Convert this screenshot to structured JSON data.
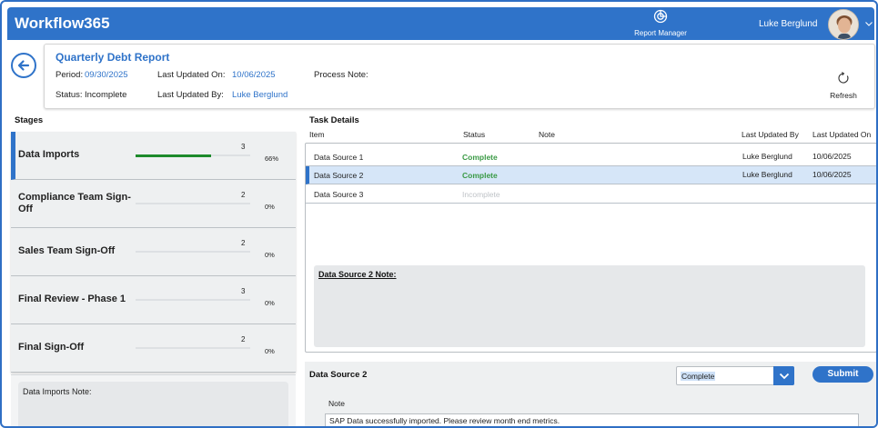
{
  "app": {
    "title": "Workflow365"
  },
  "header": {
    "report_manager_label": "Report Manager",
    "user_name": "Luke Berglund"
  },
  "report": {
    "title": "Quarterly Debt Report",
    "period_label": "Period:",
    "period_value": "09/30/2025",
    "last_updated_on_label": "Last Updated On:",
    "last_updated_on_value": "10/06/2025",
    "process_note_label": "Process Note:",
    "status_label": "Status:",
    "status_value": "Incomplete",
    "last_updated_by_label": "Last Updated By:",
    "last_updated_by_value": "Luke Berglund",
    "refresh_label": "Refresh"
  },
  "stages": {
    "title": "Stages",
    "items": [
      {
        "name": "Data Imports",
        "count": "3",
        "percent_label": "66%",
        "progress": 0.66,
        "active": true
      },
      {
        "name": "Compliance Team Sign-Off",
        "count": "2",
        "percent_label": "0%",
        "progress": 0,
        "active": false
      },
      {
        "name": "Sales Team Sign-Off",
        "count": "2",
        "percent_label": "0%",
        "progress": 0,
        "active": false
      },
      {
        "name": "Final Review - Phase 1",
        "count": "3",
        "percent_label": "0%",
        "progress": 0,
        "active": false
      },
      {
        "name": "Final Sign-Off",
        "count": "2",
        "percent_label": "0%",
        "progress": 0,
        "active": false
      }
    ],
    "note_label": "Data Imports Note:"
  },
  "tasks": {
    "title": "Task Details",
    "columns": {
      "item": "Item",
      "status": "Status",
      "note": "Note",
      "last_updated_by": "Last Updated By",
      "last_updated_on": "Last Updated On"
    },
    "rows": [
      {
        "item": "Data Source 1",
        "status": "Complete",
        "last_updated_by": "Luke Berglund",
        "last_updated_on": "10/06/2025"
      },
      {
        "item": "Data Source 2",
        "status": "Complete",
        "last_updated_by": "Luke Berglund",
        "last_updated_on": "10/06/2025"
      },
      {
        "item": "Data Source 3",
        "status": "Incomplete",
        "last_updated_by": "",
        "last_updated_on": ""
      }
    ],
    "note_title": "Data Source 2 Note:"
  },
  "form": {
    "title": "Data Source 2",
    "status_selected": "Complete",
    "submit_label": "Submit",
    "note_label": "Note",
    "note_value": "SAP Data successfully imported. Please review month end metrics."
  },
  "colors": {
    "primary": "#2f73c9",
    "complete": "#3a9a45",
    "progress": "#1d8a2b",
    "incomplete": "#bfc3c7"
  }
}
